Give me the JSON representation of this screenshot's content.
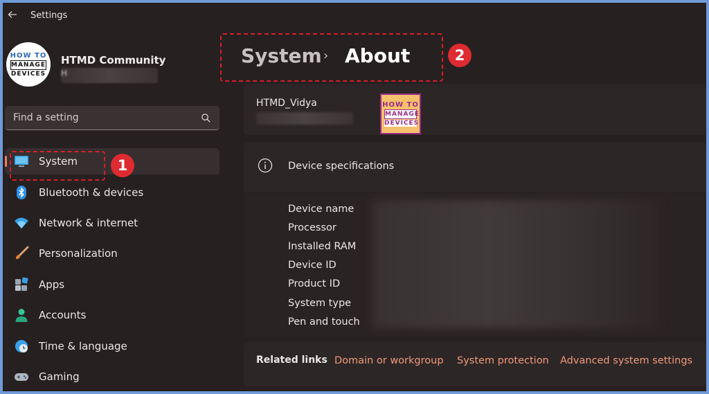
{
  "window": {
    "title": "Settings"
  },
  "profile": {
    "name": "HTMD Community",
    "email_visible": "H"
  },
  "logo": {
    "line1": "HOW TO",
    "line2": "MANAGE",
    "line3": "DEVICES"
  },
  "search": {
    "placeholder": "Find a setting"
  },
  "sidebar": {
    "items": [
      {
        "label": "System",
        "icon": "monitor-icon"
      },
      {
        "label": "Bluetooth & devices",
        "icon": "bluetooth-icon"
      },
      {
        "label": "Network & internet",
        "icon": "wifi-icon"
      },
      {
        "label": "Personalization",
        "icon": "brush-icon"
      },
      {
        "label": "Apps",
        "icon": "apps-icon"
      },
      {
        "label": "Accounts",
        "icon": "person-icon"
      },
      {
        "label": "Time & language",
        "icon": "clock-globe-icon"
      },
      {
        "label": "Gaming",
        "icon": "gamepad-icon"
      }
    ]
  },
  "annotations": {
    "one": "1",
    "two": "2"
  },
  "breadcrumb": {
    "parent": "System",
    "separator": "›",
    "current": "About"
  },
  "device": {
    "name": "HTMD_Vidya"
  },
  "specs": {
    "title": "Device specifications",
    "labels": [
      "Device name",
      "Processor",
      "Installed RAM",
      "Device ID",
      "Product ID",
      "System type",
      "Pen and touch"
    ]
  },
  "related": {
    "title": "Related links",
    "links": [
      "Domain or workgroup",
      "System protection",
      "Advanced system settings"
    ]
  },
  "colors": {
    "accent": "#f07c5b",
    "link": "#f09a7a",
    "annotation": "#de2b31",
    "background": "#272020"
  }
}
